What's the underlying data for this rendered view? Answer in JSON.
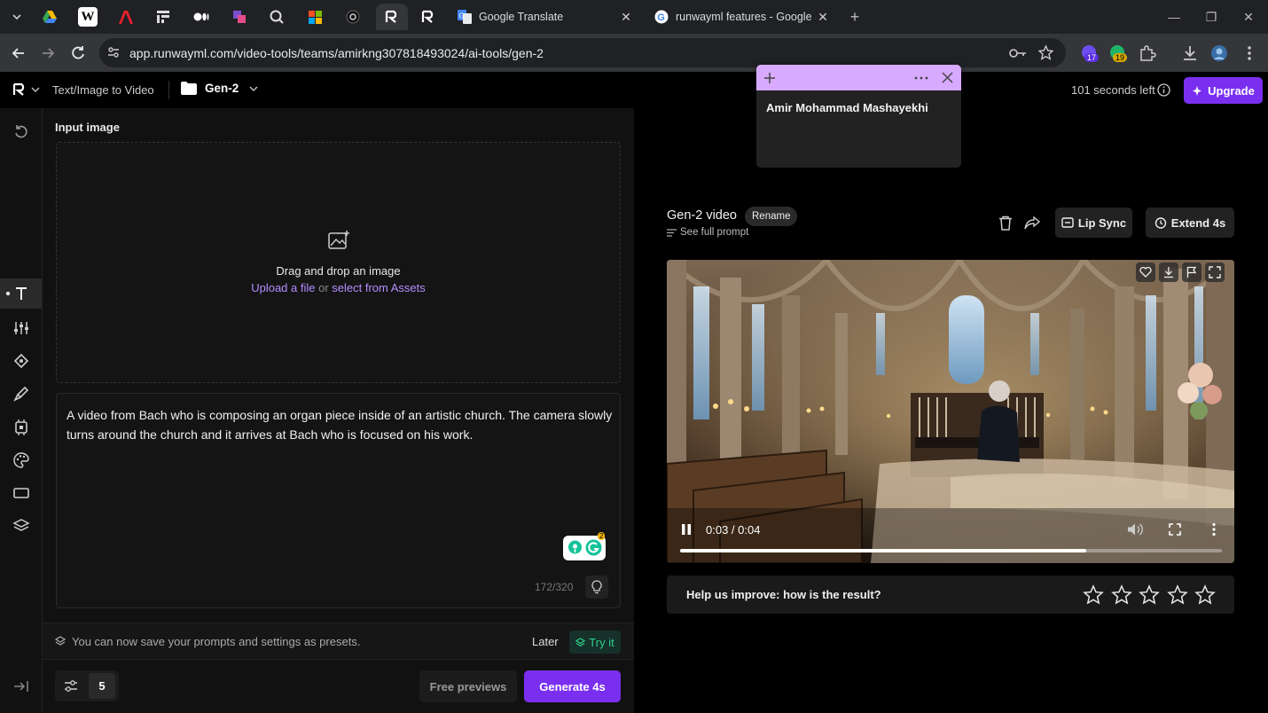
{
  "browser": {
    "tabs": [
      {
        "label": "Google Translate",
        "icon": "google-translate-icon"
      },
      {
        "label": "runwayml features - Google Se",
        "icon": "google-icon"
      }
    ],
    "url": "app.runwayml.com/video-tools/teams/amirkng307818493024/ai-tools/gen-2",
    "ext_badge_1": "17",
    "ext_badge_2": "19"
  },
  "header": {
    "mode": "Text/Image to Video",
    "project": "Gen-2",
    "time_left": "101 seconds left",
    "upgrade": "Upgrade"
  },
  "sticky_note": {
    "text": "Amir Mohammad Mashayekhi",
    "color": "#d7a9ff"
  },
  "input": {
    "label": "Input image",
    "drop_text": "Drag and drop an image",
    "upload": "Upload a file",
    "or": "or",
    "assets": "select from Assets"
  },
  "prompt": {
    "text": "A video from Bach who is composing an organ piece inside of an artistic church. The camera slowly turns around the church and it arrives at Bach who is focused on his work.",
    "counter": "172/320",
    "grammarly_badge": "2"
  },
  "presets": {
    "message": "You can now save your prompts and settings as presets.",
    "later": "Later",
    "try": "Try it"
  },
  "footer": {
    "count": "5",
    "free_previews": "Free previews",
    "generate": "Generate 4s"
  },
  "video": {
    "title": "Gen-2 video",
    "rename": "Rename",
    "see_prompt": "See full prompt",
    "lip_sync": "Lip Sync",
    "extend": "Extend 4s",
    "time": "0:03 / 0:04",
    "progress": 0.75
  },
  "feedback": {
    "text": "Help us improve: how is the result?",
    "rating": 0,
    "max": 5
  },
  "colors": {
    "accent": "#7a2ff0",
    "link": "#b38cff",
    "try_green": "#2fd08a"
  }
}
